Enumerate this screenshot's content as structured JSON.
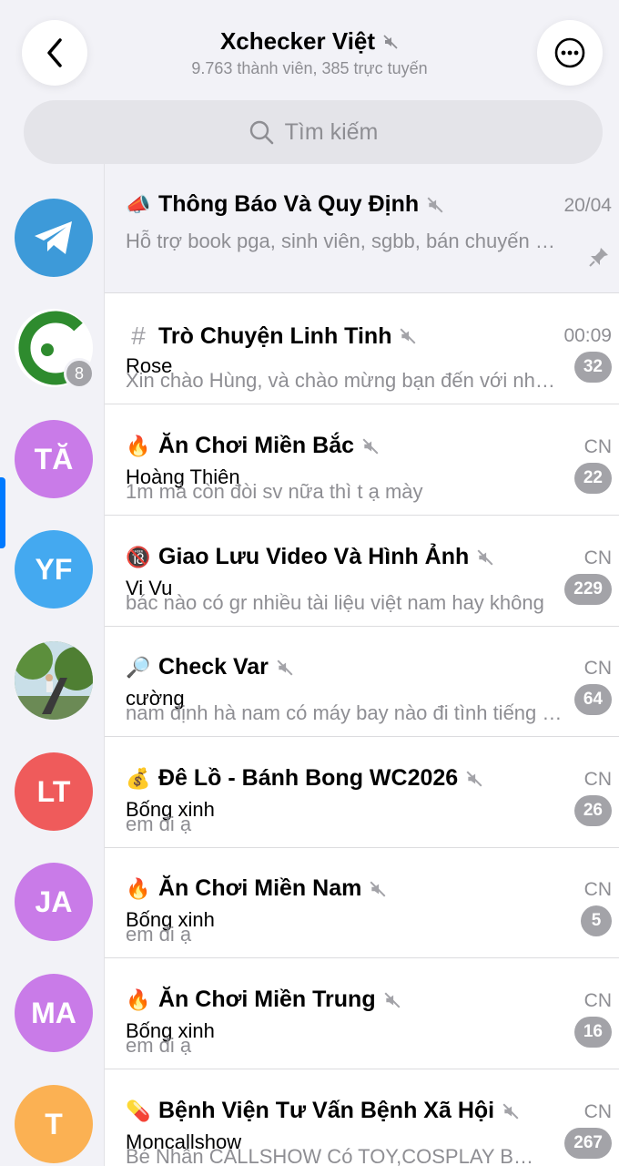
{
  "header": {
    "title": "Xchecker Việt",
    "subtitle": "9.763 thành viên, 385 trực tuyến"
  },
  "search": {
    "placeholder": "Tìm kiếm"
  },
  "sidebar": {
    "avatars": [
      {
        "initials": "",
        "color": "#3d9ad9",
        "kind": "telegram"
      },
      {
        "initials": "",
        "color": "#ffffff",
        "kind": "green-c",
        "badge": "8"
      },
      {
        "initials": "TĂ",
        "color": "#c97be8"
      },
      {
        "initials": "YF",
        "color": "#44a9f0"
      },
      {
        "initials": "",
        "color": "#6b9b4f",
        "kind": "photo"
      },
      {
        "initials": "LT",
        "color": "#ef5b5b"
      },
      {
        "initials": "JA",
        "color": "#c97be8"
      },
      {
        "initials": "MA",
        "color": "#c97be8"
      },
      {
        "initials": "T",
        "color": "#fbb153"
      }
    ]
  },
  "topics": [
    {
      "icon": "📣",
      "title": "Thông Báo Và Quy Định",
      "time": "20/04",
      "sender": "",
      "preview": "Hỗ trợ book pga, sinh viên, sgbb, bán chuyến bay",
      "count": "",
      "pinned": true
    },
    {
      "icon": "#",
      "title": "Trò Chuyện Linh Tinh",
      "time": "00:09",
      "sender": "Rose",
      "preview": "Xin chào Hùng, và chào mừng bạn đến với nhóm",
      "count": "32"
    },
    {
      "icon": "🔥",
      "title": "Ăn Chơi Miền Bắc",
      "time": "CN",
      "sender": "Hoàng Thiên",
      "preview": "1m mà còn đòi sv nữa thì t ạ mày",
      "count": "22"
    },
    {
      "icon": "🔞",
      "title": "Giao Lưu Video Và Hình Ảnh",
      "time": "CN",
      "sender": "Vi Vu",
      "preview": "bác nào có gr nhiều tài liệu việt nam hay không",
      "count": "229"
    },
    {
      "icon": "🔎",
      "title": "Check Var",
      "time": "CN",
      "sender": "cường",
      "preview": "nam định hà nam có máy bay nào đi tình tiếng không",
      "count": "64"
    },
    {
      "icon": "💰",
      "title": "Đê Lồ - Bánh Bong WC2026",
      "time": "CN",
      "sender": "Bống xinh",
      "preview": "em đi ạ",
      "count": "26"
    },
    {
      "icon": "🔥",
      "title": "Ăn Chơi Miền Nam",
      "time": "CN",
      "sender": "Bống xinh",
      "preview": "em đi ạ",
      "count": "5"
    },
    {
      "icon": "🔥",
      "title": "Ăn Chơi Miền Trung",
      "time": "CN",
      "sender": "Bống xinh",
      "preview": "em đi ạ",
      "count": "16"
    },
    {
      "icon": "💊",
      "title": "Bệnh Viện Tư Vấn Bệnh Xã Hội",
      "time": "CN",
      "sender": "Moncallshow",
      "preview": "Bé Nhân CALLSHOW Có TOY,COSPLAY Bú Mút",
      "count": "267"
    }
  ]
}
